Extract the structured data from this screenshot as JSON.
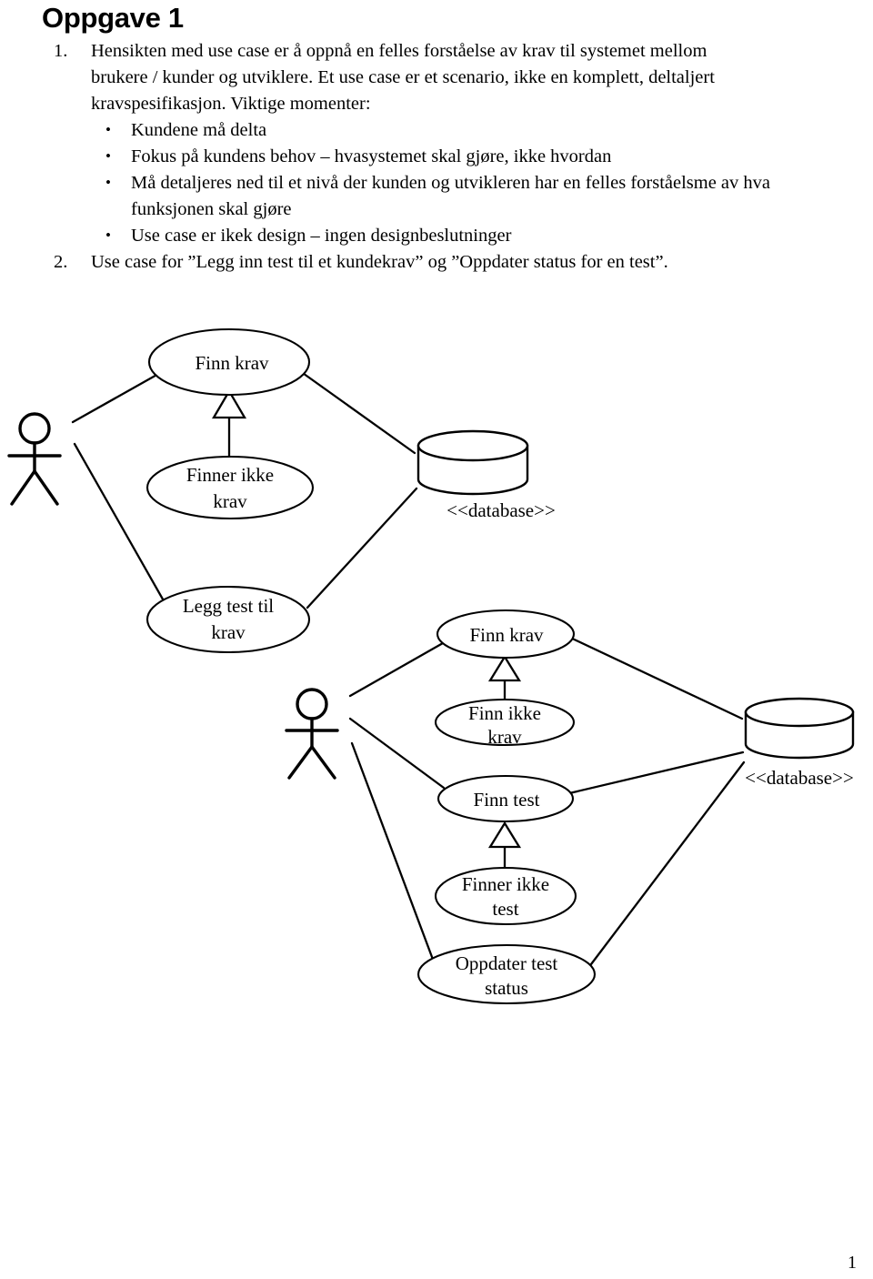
{
  "document": {
    "title": "Oppgave 1",
    "page_number": "1",
    "items": [
      {
        "number": "1.",
        "paragraphs": [
          "Hensikten med use case er å oppnå en felles forståelse av krav til systemet mellom",
          "brukere / kunder og utviklere. Et use case er et scenario, ikke en komplett, deltaljert",
          "kravspesifikasjon. Viktige momenter:"
        ],
        "bullets": [
          "Kundene må delta",
          "Fokus på kundens behov – hvasystemet skal gjøre, ikke hvordan",
          "Må detaljeres ned til et nivå der kunden og utvikleren har en felles forståelsme av hva",
          "funksjonen skal gjøre",
          "Use case er ikek design – ingen designbeslutninger"
        ],
        "bullet_marks": [
          "•",
          "•",
          "•",
          "",
          "•"
        ]
      },
      {
        "number": "2.",
        "paragraphs": [
          "Use case for ”Legg inn test til et kundekrav” og ”Oppdater status for en test”."
        ],
        "bullets": [],
        "bullet_marks": []
      }
    ]
  },
  "diagrams": [
    {
      "name": "legg-inn-test-til-kundekrav",
      "actor": {
        "label": ""
      },
      "use_cases": [
        {
          "id": "d1-finn-krav",
          "label": "Finn krav"
        },
        {
          "id": "d1-finner-ikke-krav",
          "label_line1": "Finner ikke",
          "label_line2": "krav"
        },
        {
          "id": "d1-legg-test-til-krav",
          "label_line1": "Legg test til",
          "label_line2": "krav"
        }
      ],
      "database": {
        "id": "d1-database",
        "label": "<<database>>"
      }
    },
    {
      "name": "oppdater-status-for-en-test",
      "actor": {
        "label": ""
      },
      "use_cases": [
        {
          "id": "d2-finn-krav",
          "label": "Finn krav"
        },
        {
          "id": "d2-finn-ikke-krav",
          "label_line1": "Finn ikke",
          "label_line2": "krav"
        },
        {
          "id": "d2-finn-test",
          "label": "Finn test"
        },
        {
          "id": "d2-finner-ikke-test",
          "label_line1": "Finner ikke",
          "label_line2": "test"
        },
        {
          "id": "d2-oppdater-test-status",
          "label_line1": "Oppdater test",
          "label_line2": "status"
        }
      ],
      "database": {
        "id": "d2-database",
        "label": "<<database>>"
      }
    }
  ]
}
